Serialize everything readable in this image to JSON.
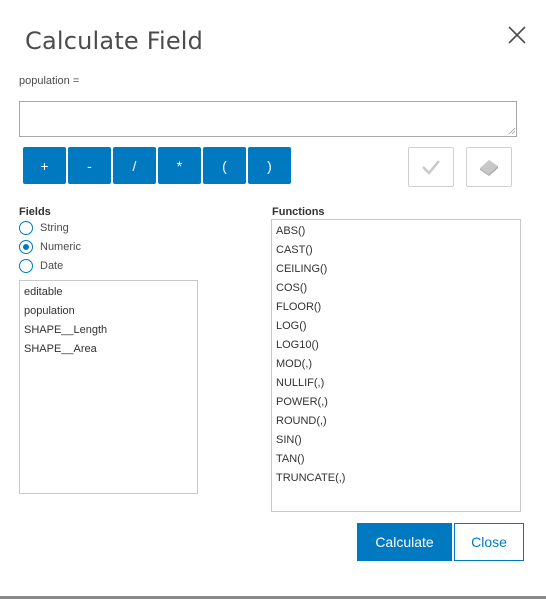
{
  "dialog": {
    "title": "Calculate Field",
    "expression_label": "population =",
    "expression_value": ""
  },
  "operators": [
    "+",
    "-",
    "/",
    "*",
    "(",
    ")"
  ],
  "fields": {
    "label": "Fields",
    "types": [
      {
        "label": "String",
        "checked": false
      },
      {
        "label": "Numeric",
        "checked": true
      },
      {
        "label": "Date",
        "checked": false
      }
    ],
    "items": [
      "editable",
      "population",
      "SHAPE__Length",
      "SHAPE__Area"
    ]
  },
  "functions": {
    "label": "Functions",
    "items": [
      "ABS()",
      "CAST()",
      "CEILING()",
      "COS()",
      "FLOOR()",
      "LOG()",
      "LOG10()",
      "MOD(,)",
      "NULLIF(,)",
      "POWER(,)",
      "ROUND(,)",
      "SIN()",
      "TAN()",
      "TRUNCATE(,)"
    ]
  },
  "buttons": {
    "calculate": "Calculate",
    "close": "Close"
  },
  "icons": {
    "close": "close-icon",
    "validate": "checkmark-icon",
    "clear": "eraser-icon"
  },
  "colors": {
    "accent": "#0079c1",
    "disabled_icon": "#c8c8c8"
  }
}
